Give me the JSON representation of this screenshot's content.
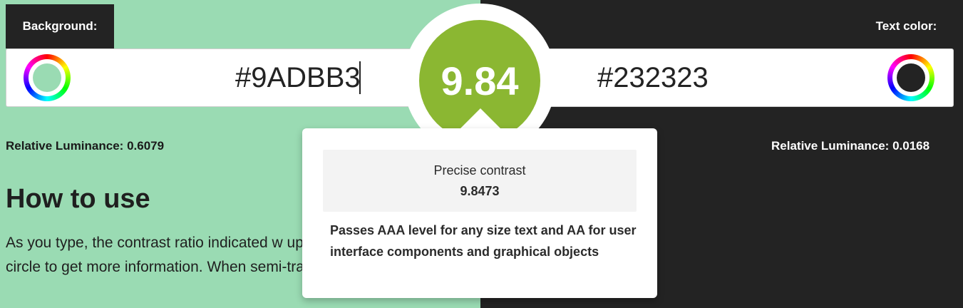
{
  "background": {
    "label": "Background:",
    "hex": "#9ADBB3",
    "color": "#9ADBB3",
    "luminance_label": "Relative Luminance:",
    "luminance_value": "0.6079"
  },
  "text_color": {
    "label": "Text color:",
    "hex": "#232323",
    "color": "#232323",
    "luminance_label": "Relative Luminance:",
    "luminance_value": "0.0168"
  },
  "contrast": {
    "score": "9.84",
    "color": "#8BB732"
  },
  "tooltip": {
    "precise_label": "Precise contrast",
    "precise_value": "9.8473",
    "passes_text": "Passes AAA level for any size text and AA for user interface components and graphical objects"
  },
  "how_to_use": {
    "title": "How to use",
    "text": "As you type, the contrast ratio indicated w update. Hover over the circle to get more information. When semi-transparent colo"
  },
  "icons": {
    "background_picker": "color-wheel-icon",
    "text_picker": "color-wheel-icon"
  }
}
